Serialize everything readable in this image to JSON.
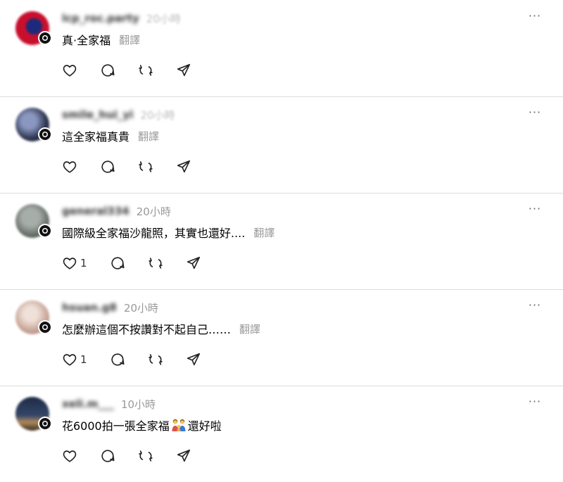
{
  "posts": [
    {
      "username": "lcp_roc.party",
      "time": "20小時",
      "text": "真·全家福",
      "translate": "翻譯",
      "likes": "",
      "avatar_colors": [
        "#c8102e",
        "#1b2a7a"
      ]
    },
    {
      "username": "smile_hui_yi",
      "time": "20小時",
      "text": "這全家福真貴",
      "translate": "翻譯",
      "likes": "",
      "avatar_colors": [
        "#6b7aa6",
        "#2e3550"
      ]
    },
    {
      "username": "general334",
      "time": "20小時",
      "text": "國際級全家福沙龍照，其實也還好....",
      "translate": "翻譯",
      "likes": "1",
      "avatar_colors": [
        "#8a8f8a",
        "#4a524c"
      ]
    },
    {
      "username": "hsuan.g8",
      "time": "20小時",
      "text": "怎麼辦這個不按讚對不起自己……",
      "translate": "翻譯",
      "likes": "1",
      "avatar_colors": [
        "#d9c2b6",
        "#b48e80"
      ]
    },
    {
      "username": "xeli.m___",
      "time": "10小時",
      "text_before": "花6000拍一張全家福",
      "text_after": "還好啦",
      "likes": "",
      "avatar_colors": [
        "#1d2b45",
        "#b08a5a"
      ]
    }
  ],
  "icons": {
    "like": "heart-icon",
    "reply": "comment-icon",
    "repost": "repost-icon",
    "share": "share-icon",
    "more": "more-icon"
  },
  "more_label": "···"
}
